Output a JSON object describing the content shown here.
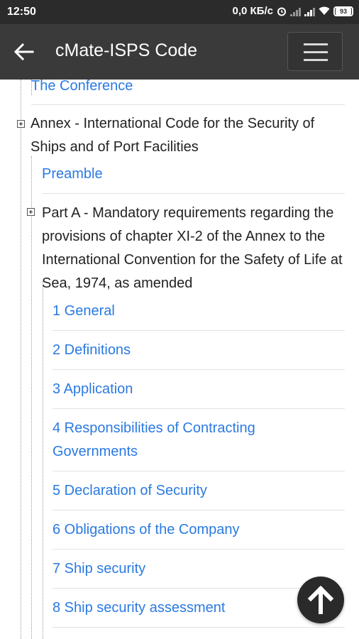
{
  "status": {
    "time": "12:50",
    "net_speed": "0,0 КБ/с",
    "battery": "93"
  },
  "appbar": {
    "title": "cMate-ISPS Code"
  },
  "tree": {
    "conference": "The Conference",
    "annex": "Annex - International Code for the Security of Ships and of Port Facilities",
    "preamble": "Preamble",
    "part_a": "Part A - Mandatory requirements regarding the provisions of chapter XI-2 of the Annex to the International Convention for the Safety of Life at Sea, 1974, as amended",
    "items": [
      "1 General",
      "2 Definitions",
      "3 Application",
      "4 Responsibilities of Contracting Governments",
      "5 Declaration of Security",
      "6 Obligations of the Company",
      "7 Ship security",
      "8 Ship security assessment"
    ]
  },
  "icons": {
    "back": "arrow-left-icon",
    "menu": "hamburger-icon",
    "expand": "plus-box-icon",
    "scroll_top": "arrow-up-icon"
  },
  "colors": {
    "link": "#2a7ae2",
    "appbar": "#3a3a3a",
    "statusbar": "#2b2b2b"
  }
}
